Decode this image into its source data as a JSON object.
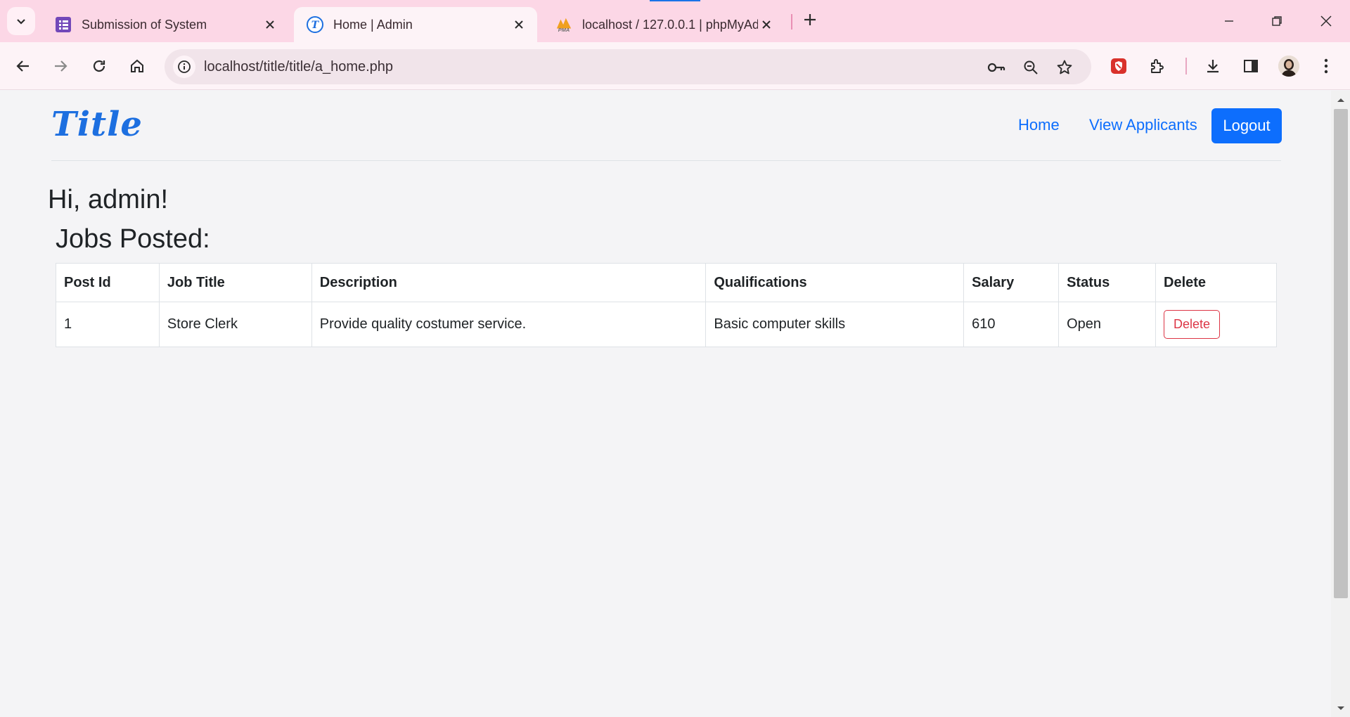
{
  "browser": {
    "tabs": [
      {
        "title": "Submission of System",
        "active": false,
        "favicon": "forms-icon"
      },
      {
        "title": "Home | Admin",
        "active": true,
        "favicon": "title-site-icon"
      },
      {
        "title": "localhost / 127.0.0.1 | phpMyAd",
        "active": false,
        "favicon": "phpmyadmin-icon"
      }
    ],
    "url": "localhost/title/title/a_home.php",
    "colors": {
      "tabstrip": "#fcd7e6",
      "toolbar": "#fdf3f7",
      "accent": "#1a73e8"
    }
  },
  "navbar": {
    "brand": "Title",
    "links": [
      "Home",
      "View Applicants"
    ],
    "logout_label": "Logout"
  },
  "main": {
    "greeting": "Hi, admin!",
    "jobs_heading": "Jobs Posted:",
    "table": {
      "columns": [
        "Post Id",
        "Job Title",
        "Description",
        "Qualifications",
        "Salary",
        "Status",
        "Delete"
      ],
      "rows": [
        {
          "post_id": "1",
          "job_title": "Store Clerk",
          "description": "Provide quality costumer service.",
          "qualifications": "Basic computer skills",
          "salary": "610",
          "status": "Open",
          "delete_label": "Delete"
        }
      ]
    }
  },
  "colors": {
    "primary": "#0d6efd",
    "danger": "#dc3545",
    "page_bg": "#f4f4f6"
  }
}
